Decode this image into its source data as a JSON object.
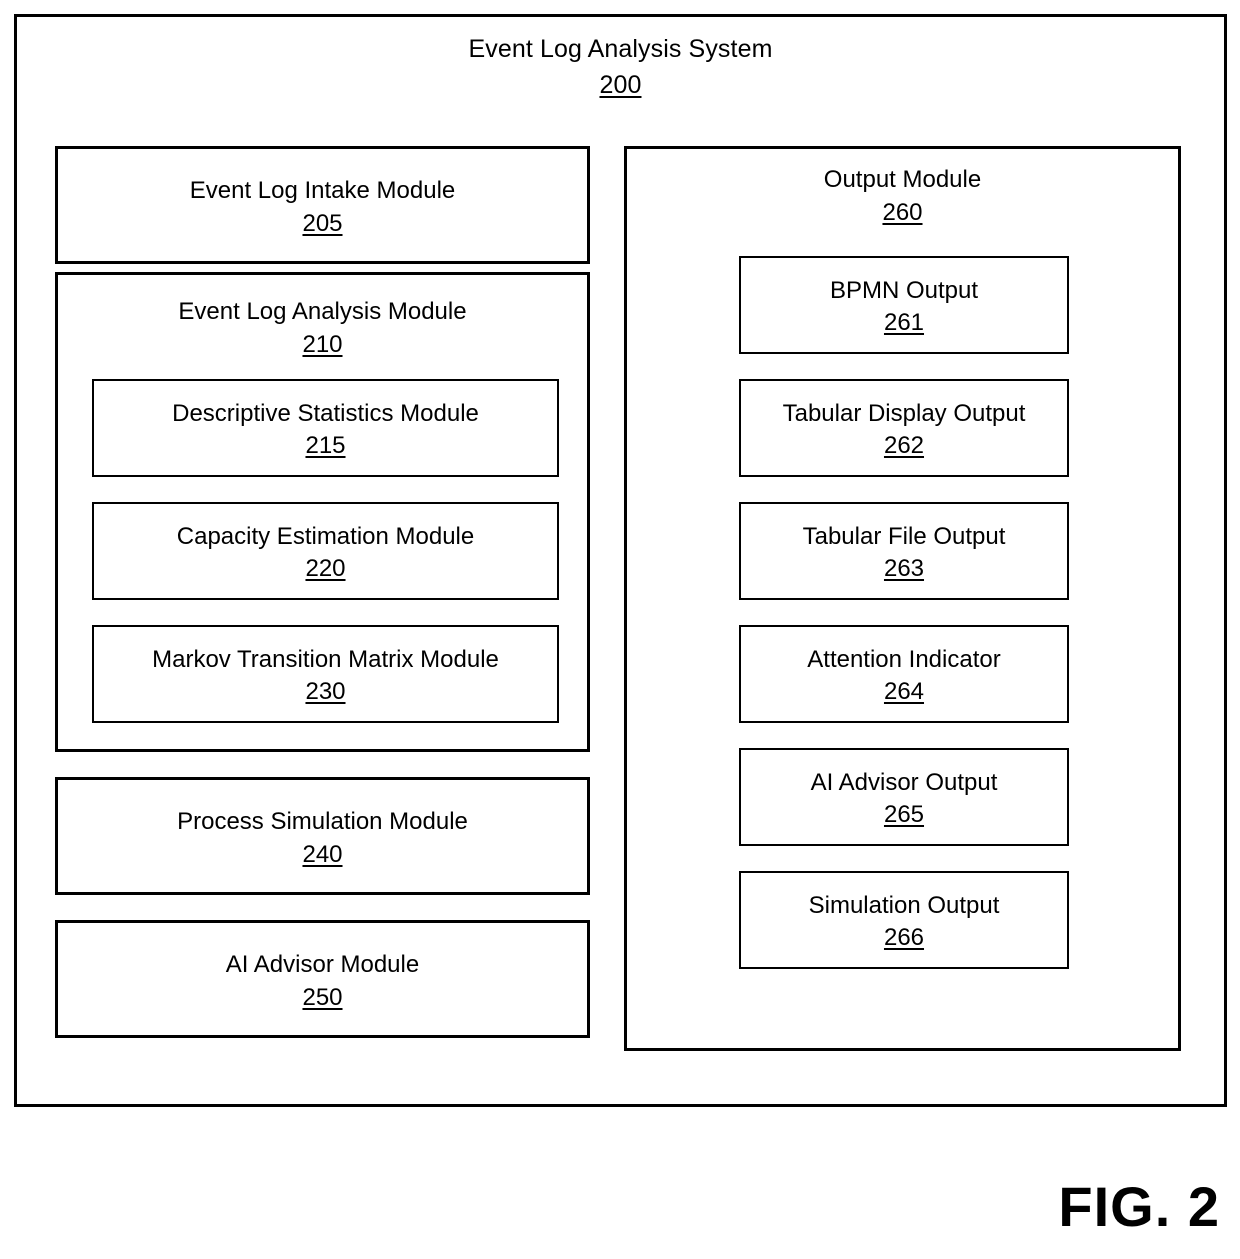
{
  "figure": {
    "caption": "FIG. 2"
  },
  "system": {
    "title": "Event Log Analysis System",
    "ref": "200"
  },
  "left_column": {
    "intake": {
      "label": "Event Log Intake Module",
      "ref": "205"
    },
    "analysis": {
      "label": "Event Log Analysis Module",
      "ref": "210",
      "submodules": [
        {
          "label": "Descriptive Statistics Module",
          "ref": "215"
        },
        {
          "label": "Capacity Estimation Module",
          "ref": "220"
        },
        {
          "label": "Markov Transition Matrix Module",
          "ref": "230"
        }
      ]
    },
    "simulation": {
      "label": "Process Simulation Module",
      "ref": "240"
    },
    "advisor": {
      "label": "AI Advisor Module",
      "ref": "250"
    }
  },
  "right_column": {
    "output": {
      "label": "Output Module",
      "ref": "260",
      "items": [
        {
          "label": "BPMN Output",
          "ref": "261"
        },
        {
          "label": "Tabular Display Output",
          "ref": "262"
        },
        {
          "label": "Tabular File Output",
          "ref": "263"
        },
        {
          "label": "Attention Indicator",
          "ref": "264"
        },
        {
          "label": "AI Advisor Output",
          "ref": "265"
        },
        {
          "label": "Simulation Output",
          "ref": "266"
        }
      ]
    }
  },
  "colors": {
    "stroke": "#000000",
    "background": "#ffffff",
    "text": "#000000"
  }
}
